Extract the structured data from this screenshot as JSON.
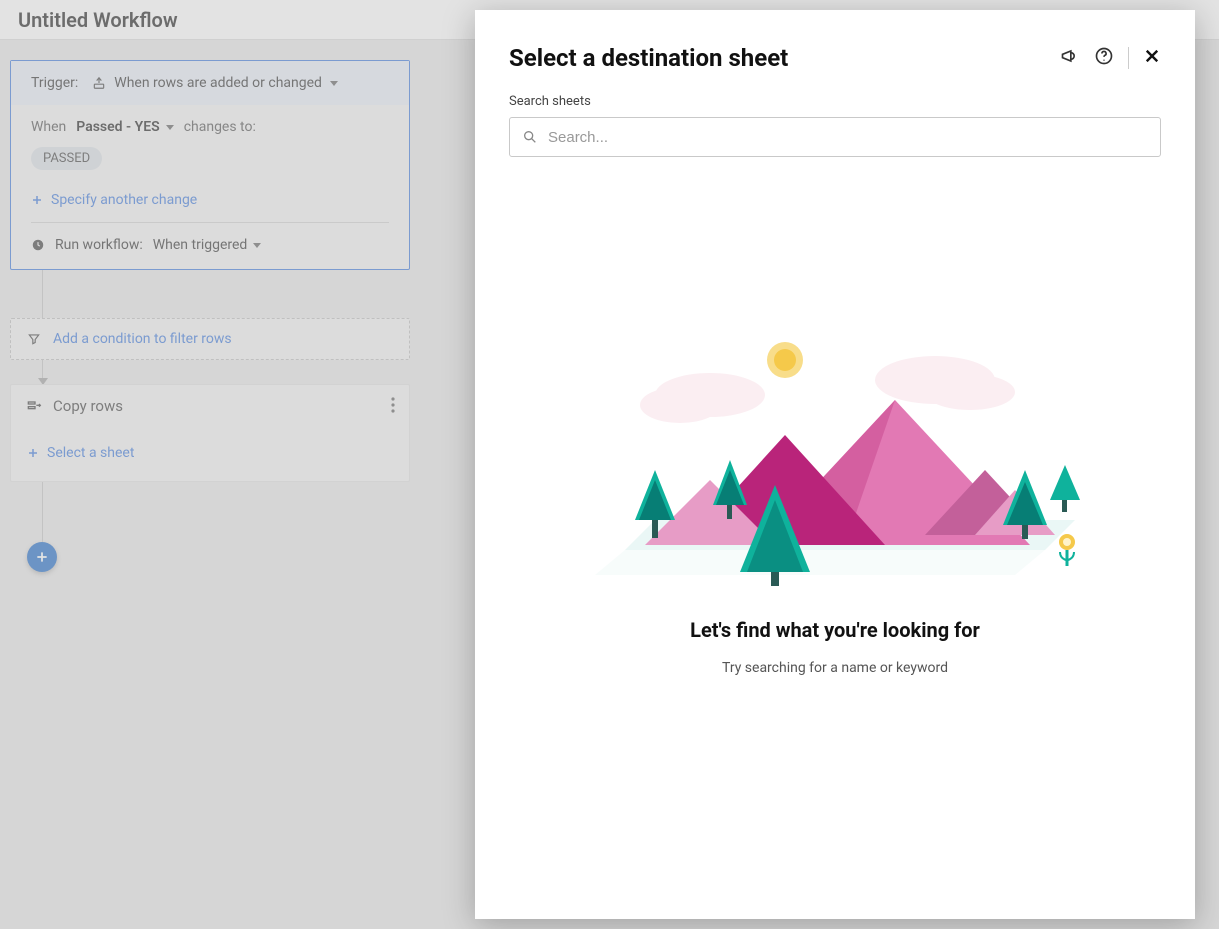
{
  "page": {
    "title": "Untitled Workflow"
  },
  "trigger": {
    "label": "Trigger:",
    "type": "When rows are added or changed",
    "when_label": "When",
    "field": "Passed - YES",
    "changes_to": "changes to:",
    "value_pill": "PASSED",
    "specify_link": "Specify another change",
    "run_workflow_label": "Run workflow:",
    "run_schedule": "When triggered"
  },
  "condition": {
    "link": "Add a condition to filter rows"
  },
  "action": {
    "title": "Copy rows",
    "select_sheet": "Select a sheet"
  },
  "panel": {
    "title": "Select a destination sheet",
    "search_label": "Search sheets",
    "search_placeholder": "Search...",
    "empty_title": "Let's find what you're looking for",
    "empty_sub": "Try searching for a name or keyword"
  }
}
